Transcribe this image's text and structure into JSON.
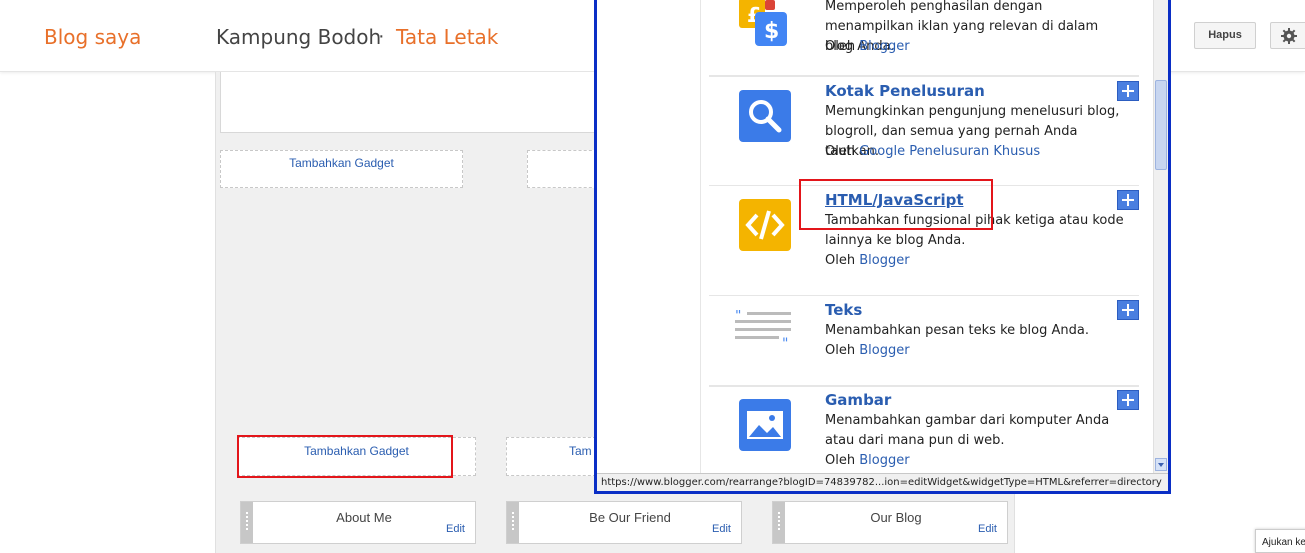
{
  "header": {
    "brand": "Blog saya",
    "blog_name": "Kampung Bodoh",
    "separator": "·",
    "section": "Tata Letak",
    "delete_label": "Hapus",
    "settings_icon": "gear-icon"
  },
  "layout": {
    "add_gadget_label": "Tambahkan Gadget",
    "add_gadget_label_partial": "Tam",
    "widgets": [
      {
        "title": "About Me",
        "edit": "Edit"
      },
      {
        "title": "Be Our Friend",
        "edit": "Edit"
      },
      {
        "title": "Our Blog",
        "edit": "Edit"
      }
    ]
  },
  "popup": {
    "items": [
      {
        "title": "",
        "desc": "Memperoleh penghasilan dengan menampilkan iklan yang relevan di dalam blog Anda.",
        "by": "Oleh",
        "by_link": "Blogger",
        "icon": "adsense-icon"
      },
      {
        "title": "Kotak Penelusuran",
        "desc": "Memungkinkan pengunjung menelusuri blog, blogroll, dan semua yang pernah Anda tautkan.",
        "by": "Oleh",
        "by_link": "Google Penelusuran Khusus",
        "icon": "search-icon"
      },
      {
        "title": "HTML/JavaScript",
        "desc": "Tambahkan fungsional pihak ketiga atau kode lainnya ke blog Anda.",
        "by": "Oleh",
        "by_link": "Blogger",
        "icon": "code-icon"
      },
      {
        "title": "Teks",
        "desc": "Menambahkan pesan teks ke blog Anda.",
        "by": "Oleh",
        "by_link": "Blogger",
        "icon": "text-quote-icon"
      },
      {
        "title": "Gambar",
        "desc": "Menambahkan gambar dari komputer Anda atau dari mana pun di web.",
        "by": "Oleh",
        "by_link": "Blogger",
        "icon": "image-icon"
      }
    ],
    "status_url": "https://www.blogger.com/rearrange?blogID=74839782...ion=editWidget&widgetType=HTML&referrer=directory"
  },
  "footer_tab": "Ajukan ke",
  "colors": {
    "brand": "#e8702a",
    "link": "#2a5db0",
    "highlight": "#e3151a",
    "popup_border": "#0a2ec5"
  }
}
